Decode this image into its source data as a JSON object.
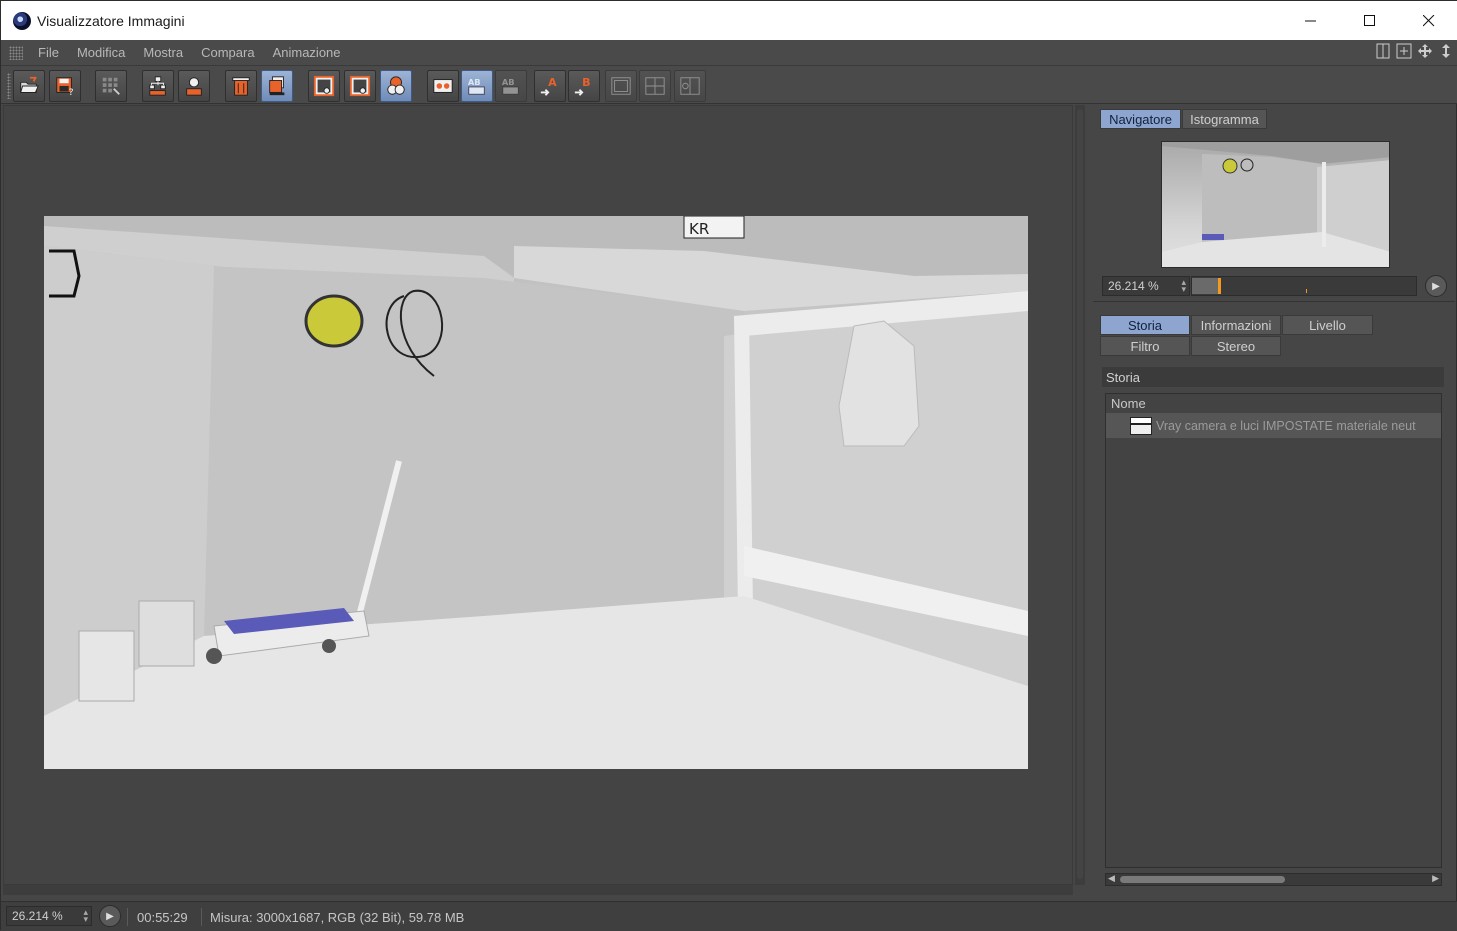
{
  "window": {
    "title": "Visualizzatore Immagini"
  },
  "menu": {
    "items": [
      "File",
      "Modifica",
      "Mostra",
      "Compara",
      "Animazione"
    ]
  },
  "toolbar": {
    "buttons": [
      {
        "name": "open-file-button",
        "icon": "folder-open-icon"
      },
      {
        "name": "save-file-button",
        "icon": "save-icon"
      },
      {
        "name": "image-filter-button",
        "icon": "grid-icon"
      },
      {
        "name": "add-to-stack-button",
        "icon": "tree-add-icon"
      },
      {
        "name": "user-button",
        "icon": "user-icon"
      },
      {
        "name": "remove-image-button",
        "icon": "delete-icon"
      },
      {
        "name": "stack-button",
        "icon": "stack-icon"
      },
      {
        "name": "show-region-button",
        "icon": "region-icon"
      },
      {
        "name": "render-region-button",
        "icon": "region-render-icon"
      },
      {
        "name": "compare-mode-button",
        "icon": "compare-icon"
      },
      {
        "name": "ab-view-button",
        "icon": "ab-icon",
        "label": "AB"
      },
      {
        "name": "ab-active-button",
        "icon": "ab-active-icon",
        "label": "AB"
      },
      {
        "name": "ab-dim-button",
        "icon": "ab-dim-icon",
        "label": "AB"
      },
      {
        "name": "set-a-button",
        "icon": "set-a-icon",
        "label": "A"
      },
      {
        "name": "set-b-button",
        "icon": "set-b-icon",
        "label": "B"
      },
      {
        "name": "layout-1-button",
        "icon": "layout-icon"
      },
      {
        "name": "layout-2-button",
        "icon": "layout-icon"
      },
      {
        "name": "layout-3-button",
        "icon": "layout-icon"
      }
    ]
  },
  "navigator": {
    "tabs": [
      "Navigatore",
      "Istogramma"
    ],
    "zoom": "26.214 %",
    "slider_position": 0.12
  },
  "info_panel": {
    "tabs_row1": [
      "Storia",
      "Informazioni",
      "Livello"
    ],
    "tabs_row2": [
      "Filtro",
      "Stereo"
    ],
    "section_title": "Storia",
    "list_header": "Nome",
    "rows": [
      "Vray camera e luci IMPOSTATE materiale neut"
    ]
  },
  "status": {
    "zoom": "26.214 %",
    "time": "00:55:29",
    "info": "Misura: 3000x1687, RGB (32 Bit), 59.78 MB"
  },
  "colors": {
    "accent": "#8ea6cf",
    "orange": "#e8622a",
    "slider": "#f29a1e"
  }
}
